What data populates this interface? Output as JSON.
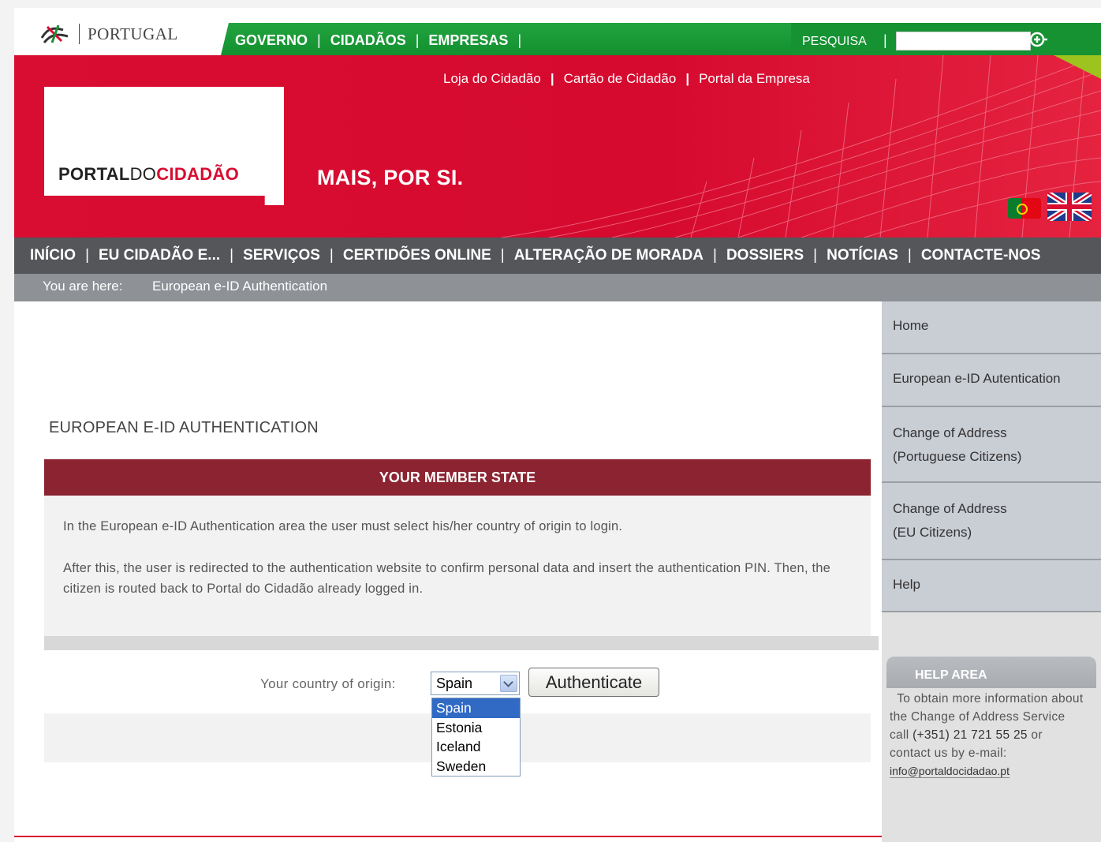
{
  "top": {
    "logo_text": "PORTUGAL",
    "nav": [
      "GOVERNO",
      "CIDADÃOS",
      "EMPRESAS"
    ],
    "search_label": "PESQUISA",
    "search_value": ""
  },
  "banner": {
    "links": [
      "Loja do Cidadão",
      "Cartão de Cidadão",
      "Portal da Empresa"
    ],
    "brand_portal": "PORTAL",
    "brand_do": "DO",
    "brand_cidadao": "CIDADÃO",
    "slogan": "MAIS, POR SI."
  },
  "mainnav": [
    "INÍCIO",
    "EU CIDADÃO E...",
    "SERVIÇOS",
    "CERTIDÕES ONLINE",
    "ALTERAÇÃO DE MORADA",
    "DOSSIERS",
    "NOTÍCIAS",
    "CONTACTE-NOS"
  ],
  "breadcrumb": {
    "label": "You are here:",
    "current": "European e-ID Authentication"
  },
  "sidebar": {
    "items": [
      {
        "line1": "Home",
        "line2": ""
      },
      {
        "line1": "European e-ID Autentication",
        "line2": ""
      },
      {
        "line1": "Change of Address",
        "line2": "(Portuguese Citizens)"
      },
      {
        "line1": "Change of Address",
        "line2": "(EU Citizens)"
      },
      {
        "line1": "Help",
        "line2": ""
      }
    ],
    "help_title": "HELP AREA",
    "help_text_1": "To obtain more information about the Change of Address Service call ",
    "help_phone": "(+351) 21 721 55 25",
    "help_text_2": " or contact us by e-mail:",
    "help_email": "info@portaldocidadao.pt"
  },
  "main": {
    "title": "EUROPEAN E-ID AUTHENTICATION",
    "section_title": "YOUR MEMBER STATE",
    "para1": "In the European e-ID Authentication area the user must select his/her country of origin to login.",
    "para2": "After this, the user is redirected to the authentication website to confirm personal data and insert the authentication PIN. Then, the citizen is routed back to Portal do Cidadão already logged in.",
    "country_label": "Your country of origin:",
    "selected_country": "Spain",
    "options": [
      "Spain",
      "Estonia",
      "Iceland",
      "Sweden"
    ],
    "button_label": "Authenticate"
  },
  "colors": {
    "brand_red": "#d80d31",
    "green": "#23a340",
    "nav_grey": "#54565a",
    "section_maroon": "#8b2330"
  }
}
